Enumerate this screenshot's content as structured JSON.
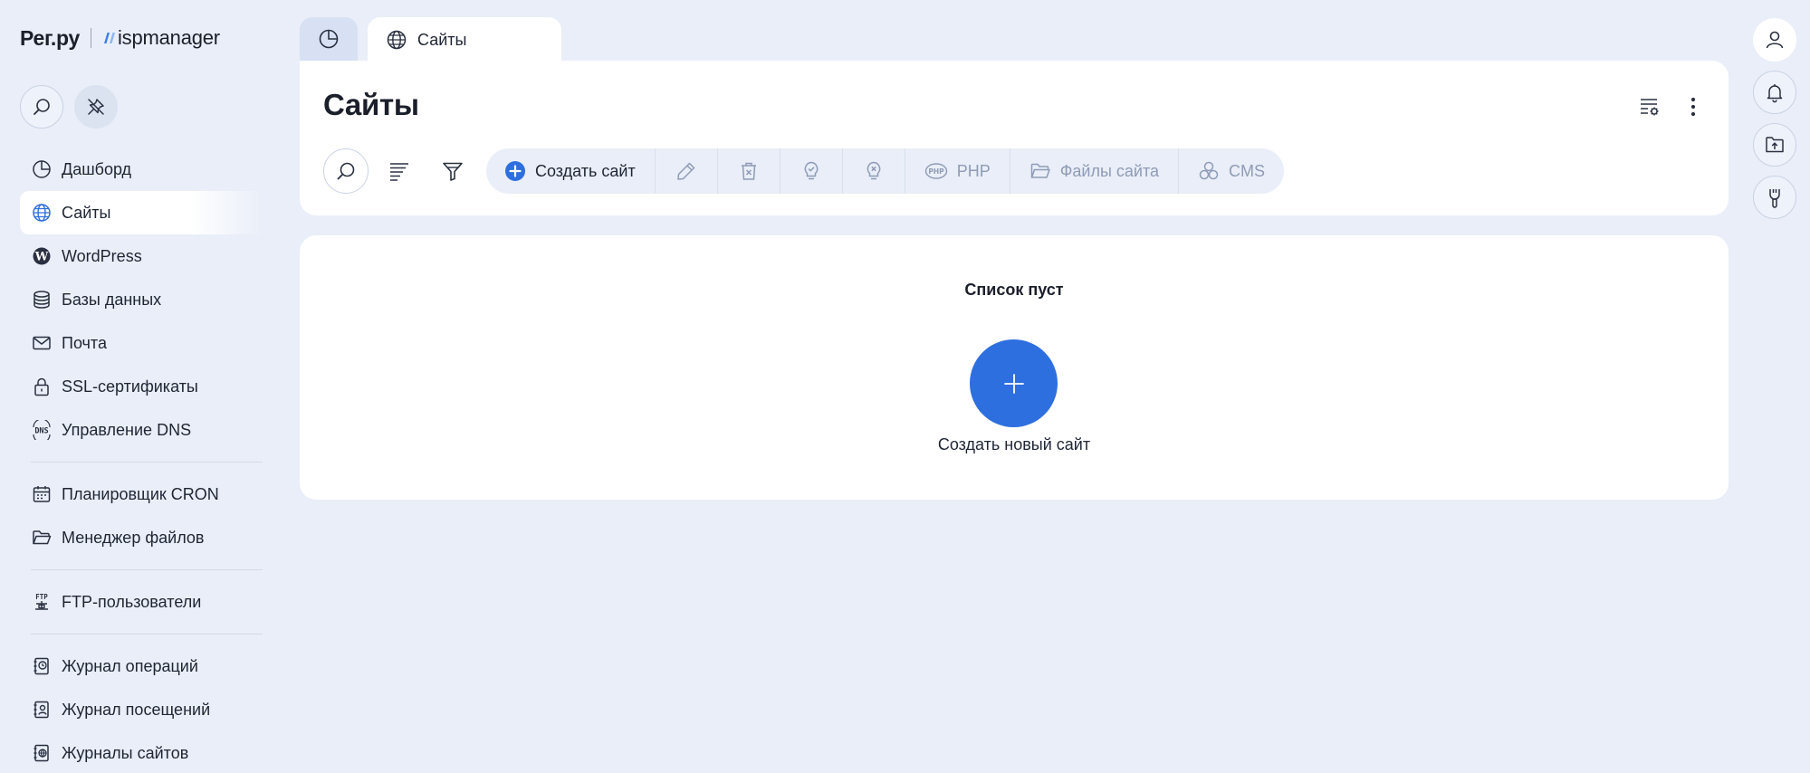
{
  "logo": {
    "brand": "Рег.ру",
    "product": "ispmanager"
  },
  "sidebar": {
    "items": [
      {
        "label": "Дашборд",
        "icon": "dashboard-icon"
      },
      {
        "label": "Сайты",
        "icon": "globe-icon",
        "active": true
      },
      {
        "label": "WordPress",
        "icon": "wordpress-icon"
      },
      {
        "label": "Базы данных",
        "icon": "database-icon"
      },
      {
        "label": "Почта",
        "icon": "mail-icon"
      },
      {
        "label": "SSL-сертификаты",
        "icon": "lock-icon"
      },
      {
        "label": "Управление DNS",
        "icon": "dns-icon"
      },
      {
        "label": "Планировщик CRON",
        "icon": "calendar-icon"
      },
      {
        "label": "Менеджер файлов",
        "icon": "folder-icon"
      },
      {
        "label": "FTP-пользователи",
        "icon": "ftp-icon"
      },
      {
        "label": "Журнал операций",
        "icon": "log-clock-icon"
      },
      {
        "label": "Журнал посещений",
        "icon": "log-user-icon"
      },
      {
        "label": "Журналы сайтов",
        "icon": "log-globe-icon"
      }
    ]
  },
  "tabs": [
    {
      "label": "",
      "icon": "dashboard-icon"
    },
    {
      "label": "Сайты",
      "icon": "globe-icon"
    }
  ],
  "header": {
    "title": "Сайты"
  },
  "toolbar": {
    "create_label": "Создать сайт",
    "php_label": "PHP",
    "files_label": "Файлы сайта",
    "cms_label": "CMS"
  },
  "list": {
    "empty_text": "Список пуст",
    "create_new_label": "Создать новый сайт"
  },
  "colors": {
    "background": "#e9eef8",
    "accent": "#2e6fdf",
    "disabled_text": "#8f9bb5",
    "card": "#ffffff"
  }
}
